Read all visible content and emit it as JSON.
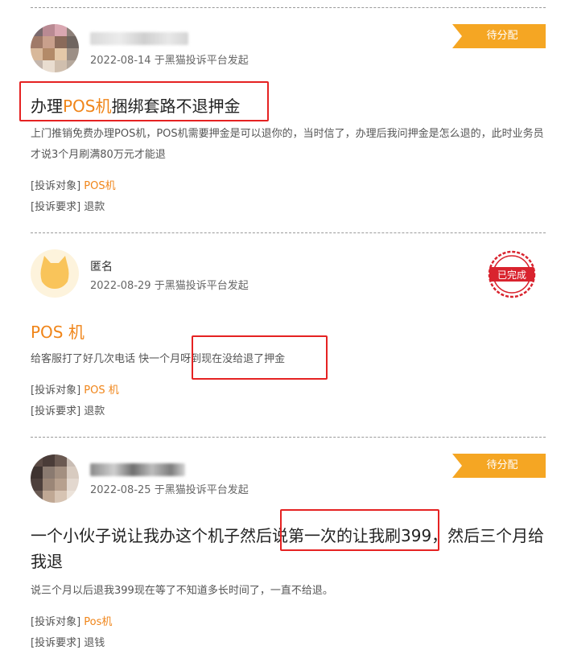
{
  "complaints": [
    {
      "user": "",
      "date": "2022-08-14",
      "platform": "于黑猫投诉平台发起",
      "status": "待分配",
      "title_pre": "办理",
      "title_hl": "POS机",
      "title_post": "捆绑套路不退押金",
      "description": "上门推销免费办理POS机，POS机需要押金是可以退你的，当时信了，办理后我问押金是怎么退的，此时业务员才说3个月刷满80万元才能退",
      "target_label": "[投诉对象]",
      "target": "POS机",
      "request_label": "[投诉要求]",
      "request": "退款"
    },
    {
      "user": "匿名",
      "date": "2022-08-29",
      "platform": "于黑猫投诉平台发起",
      "status": "已完成",
      "title": "POS 机",
      "description": "给客服打了好几次电话 快一个月呀到现在没给退了押金",
      "target_label": "[投诉对象]",
      "target": "POS 机",
      "request_label": "[投诉要求]",
      "request": "退款"
    },
    {
      "user": "",
      "date": "2022-08-25",
      "platform": "于黑猫投诉平台发起",
      "status": "待分配",
      "title_line1": "一个小伙子说让我办这个机子然后说第一次的让我刷399，然后三个月给",
      "title_line2": "我退",
      "description": "说三个月以后退我399现在等了不知道多长时间了，一直不给退。",
      "target_label": "[投诉对象]",
      "target": "Pos机",
      "request_label": "[投诉要求]",
      "request": "退钱"
    }
  ],
  "colors": {
    "accent": "#f08519",
    "pending_tag": "#f5a623",
    "stamp_red": "#d9232e",
    "annotation_red": "#e52222"
  }
}
